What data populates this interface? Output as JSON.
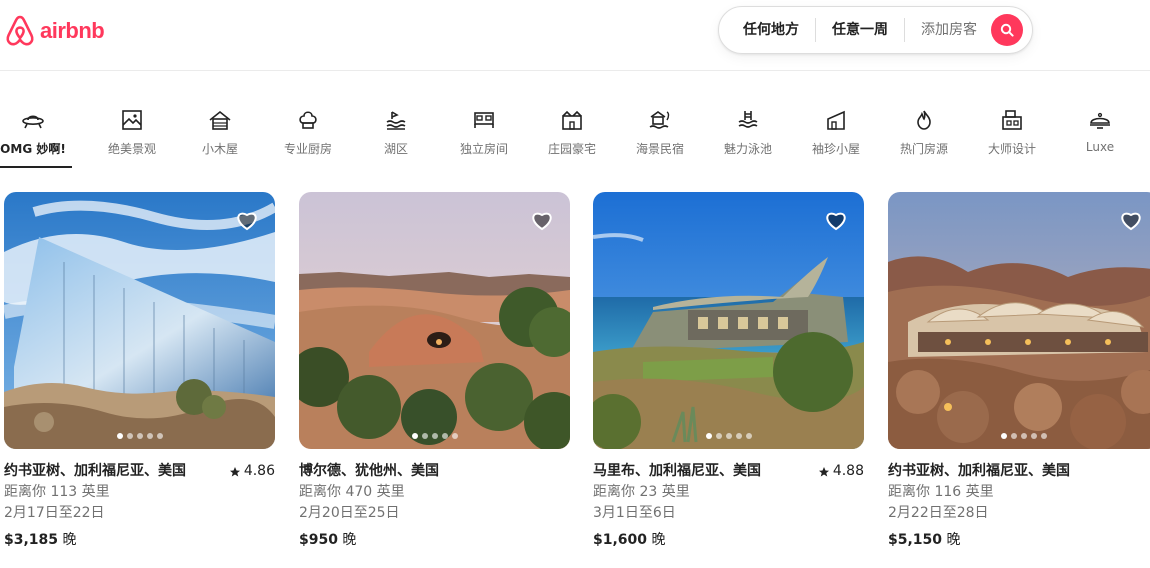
{
  "brand": {
    "name": "airbnb",
    "color": "#ff385c"
  },
  "search": {
    "where": "任何地方",
    "when": "任意一周",
    "guests": "添加房客"
  },
  "categories": [
    {
      "label": "OMG 妙啊!",
      "icon": "ufo-icon",
      "active": true
    },
    {
      "label": "绝美景观",
      "icon": "scenic-view-icon"
    },
    {
      "label": "小木屋",
      "icon": "cabin-icon"
    },
    {
      "label": "专业厨房",
      "icon": "chef-hat-icon"
    },
    {
      "label": "湖区",
      "icon": "lake-icon"
    },
    {
      "label": "独立房间",
      "icon": "private-room-icon"
    },
    {
      "label": "庄园豪宅",
      "icon": "mansion-icon"
    },
    {
      "label": "海景民宿",
      "icon": "beachfront-icon"
    },
    {
      "label": "魅力泳池",
      "icon": "pool-icon"
    },
    {
      "label": "袖珍小屋",
      "icon": "tiny-home-icon"
    },
    {
      "label": "热门房源",
      "icon": "fire-icon"
    },
    {
      "label": "大师设计",
      "icon": "design-icon"
    },
    {
      "label": "Luxe",
      "icon": "luxe-icon"
    }
  ],
  "listings": [
    {
      "location": "约书亚树、加利福尼亚、美国",
      "rating": "4.86",
      "distance": "距离你 113 英里",
      "dates": "2月17日至22日",
      "price": "$3,185",
      "unit": "晚"
    },
    {
      "location": "博尔德、犹他州、美国",
      "rating": "",
      "distance": "距离你 470 英里",
      "dates": "2月20日至25日",
      "price": "$950",
      "unit": "晚"
    },
    {
      "location": "马里布、加利福尼亚、美国",
      "rating": "4.88",
      "distance": "距离你 23 英里",
      "dates": "3月1日至6日",
      "price": "$1,600",
      "unit": "晚"
    },
    {
      "location": "约书亚树、加利福尼亚、美国",
      "rating": "",
      "distance": "距离你 116 英里",
      "dates": "2月22日至28日",
      "price": "$5,150",
      "unit": "晚"
    }
  ]
}
